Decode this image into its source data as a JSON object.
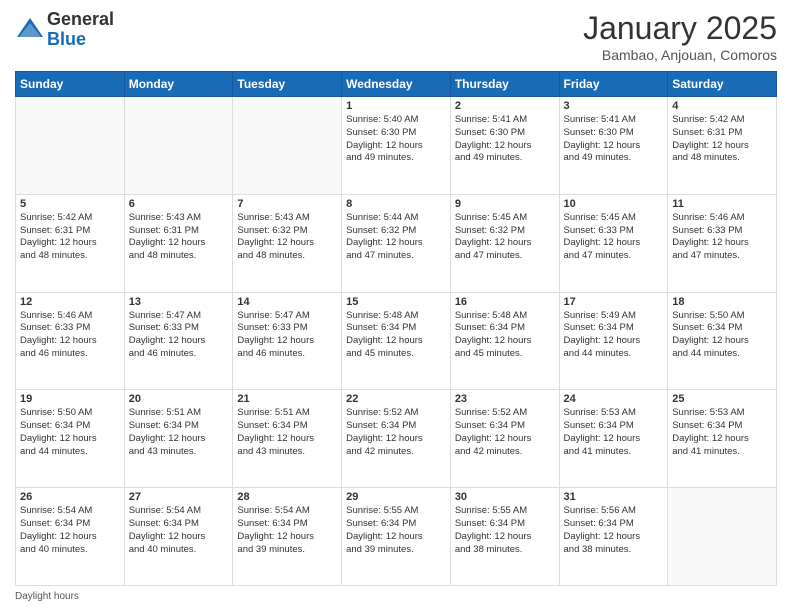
{
  "logo": {
    "general": "General",
    "blue": "Blue"
  },
  "title": "January 2025",
  "subtitle": "Bambao, Anjouan, Comoros",
  "days_of_week": [
    "Sunday",
    "Monday",
    "Tuesday",
    "Wednesday",
    "Thursday",
    "Friday",
    "Saturday"
  ],
  "footer": "Daylight hours",
  "weeks": [
    [
      {
        "day": "",
        "info": ""
      },
      {
        "day": "",
        "info": ""
      },
      {
        "day": "",
        "info": ""
      },
      {
        "day": "1",
        "info": "Sunrise: 5:40 AM\nSunset: 6:30 PM\nDaylight: 12 hours\nand 49 minutes."
      },
      {
        "day": "2",
        "info": "Sunrise: 5:41 AM\nSunset: 6:30 PM\nDaylight: 12 hours\nand 49 minutes."
      },
      {
        "day": "3",
        "info": "Sunrise: 5:41 AM\nSunset: 6:30 PM\nDaylight: 12 hours\nand 49 minutes."
      },
      {
        "day": "4",
        "info": "Sunrise: 5:42 AM\nSunset: 6:31 PM\nDaylight: 12 hours\nand 48 minutes."
      }
    ],
    [
      {
        "day": "5",
        "info": "Sunrise: 5:42 AM\nSunset: 6:31 PM\nDaylight: 12 hours\nand 48 minutes."
      },
      {
        "day": "6",
        "info": "Sunrise: 5:43 AM\nSunset: 6:31 PM\nDaylight: 12 hours\nand 48 minutes."
      },
      {
        "day": "7",
        "info": "Sunrise: 5:43 AM\nSunset: 6:32 PM\nDaylight: 12 hours\nand 48 minutes."
      },
      {
        "day": "8",
        "info": "Sunrise: 5:44 AM\nSunset: 6:32 PM\nDaylight: 12 hours\nand 47 minutes."
      },
      {
        "day": "9",
        "info": "Sunrise: 5:45 AM\nSunset: 6:32 PM\nDaylight: 12 hours\nand 47 minutes."
      },
      {
        "day": "10",
        "info": "Sunrise: 5:45 AM\nSunset: 6:33 PM\nDaylight: 12 hours\nand 47 minutes."
      },
      {
        "day": "11",
        "info": "Sunrise: 5:46 AM\nSunset: 6:33 PM\nDaylight: 12 hours\nand 47 minutes."
      }
    ],
    [
      {
        "day": "12",
        "info": "Sunrise: 5:46 AM\nSunset: 6:33 PM\nDaylight: 12 hours\nand 46 minutes."
      },
      {
        "day": "13",
        "info": "Sunrise: 5:47 AM\nSunset: 6:33 PM\nDaylight: 12 hours\nand 46 minutes."
      },
      {
        "day": "14",
        "info": "Sunrise: 5:47 AM\nSunset: 6:33 PM\nDaylight: 12 hours\nand 46 minutes."
      },
      {
        "day": "15",
        "info": "Sunrise: 5:48 AM\nSunset: 6:34 PM\nDaylight: 12 hours\nand 45 minutes."
      },
      {
        "day": "16",
        "info": "Sunrise: 5:48 AM\nSunset: 6:34 PM\nDaylight: 12 hours\nand 45 minutes."
      },
      {
        "day": "17",
        "info": "Sunrise: 5:49 AM\nSunset: 6:34 PM\nDaylight: 12 hours\nand 44 minutes."
      },
      {
        "day": "18",
        "info": "Sunrise: 5:50 AM\nSunset: 6:34 PM\nDaylight: 12 hours\nand 44 minutes."
      }
    ],
    [
      {
        "day": "19",
        "info": "Sunrise: 5:50 AM\nSunset: 6:34 PM\nDaylight: 12 hours\nand 44 minutes."
      },
      {
        "day": "20",
        "info": "Sunrise: 5:51 AM\nSunset: 6:34 PM\nDaylight: 12 hours\nand 43 minutes."
      },
      {
        "day": "21",
        "info": "Sunrise: 5:51 AM\nSunset: 6:34 PM\nDaylight: 12 hours\nand 43 minutes."
      },
      {
        "day": "22",
        "info": "Sunrise: 5:52 AM\nSunset: 6:34 PM\nDaylight: 12 hours\nand 42 minutes."
      },
      {
        "day": "23",
        "info": "Sunrise: 5:52 AM\nSunset: 6:34 PM\nDaylight: 12 hours\nand 42 minutes."
      },
      {
        "day": "24",
        "info": "Sunrise: 5:53 AM\nSunset: 6:34 PM\nDaylight: 12 hours\nand 41 minutes."
      },
      {
        "day": "25",
        "info": "Sunrise: 5:53 AM\nSunset: 6:34 PM\nDaylight: 12 hours\nand 41 minutes."
      }
    ],
    [
      {
        "day": "26",
        "info": "Sunrise: 5:54 AM\nSunset: 6:34 PM\nDaylight: 12 hours\nand 40 minutes."
      },
      {
        "day": "27",
        "info": "Sunrise: 5:54 AM\nSunset: 6:34 PM\nDaylight: 12 hours\nand 40 minutes."
      },
      {
        "day": "28",
        "info": "Sunrise: 5:54 AM\nSunset: 6:34 PM\nDaylight: 12 hours\nand 39 minutes."
      },
      {
        "day": "29",
        "info": "Sunrise: 5:55 AM\nSunset: 6:34 PM\nDaylight: 12 hours\nand 39 minutes."
      },
      {
        "day": "30",
        "info": "Sunrise: 5:55 AM\nSunset: 6:34 PM\nDaylight: 12 hours\nand 38 minutes."
      },
      {
        "day": "31",
        "info": "Sunrise: 5:56 AM\nSunset: 6:34 PM\nDaylight: 12 hours\nand 38 minutes."
      },
      {
        "day": "",
        "info": ""
      }
    ]
  ]
}
